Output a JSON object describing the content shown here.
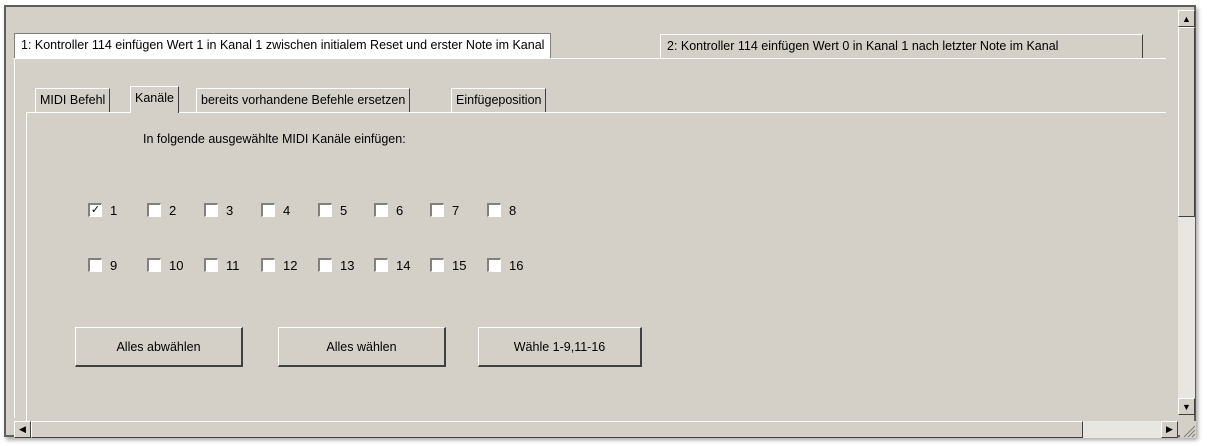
{
  "outer_tabs": [
    {
      "label": "1: Kontroller 114 einfügen Wert 1 in Kanal 1 zwischen initialem Reset und erster Note im Kanal"
    },
    {
      "label": "2: Kontroller 114 einfügen Wert 0 in Kanal 1 nach letzter Note im Kanal"
    }
  ],
  "inner_tabs": [
    {
      "label": "MIDI Befehl"
    },
    {
      "label": "Kanäle"
    },
    {
      "label": "bereits vorhandene Befehle ersetzen"
    },
    {
      "label": "Einfügeposition"
    }
  ],
  "heading": "In folgende ausgewählte MIDI Kanäle einfügen:",
  "channels": [
    {
      "label": "1",
      "checked": true
    },
    {
      "label": "2",
      "checked": false
    },
    {
      "label": "3",
      "checked": false
    },
    {
      "label": "4",
      "checked": false
    },
    {
      "label": "5",
      "checked": false
    },
    {
      "label": "6",
      "checked": false
    },
    {
      "label": "7",
      "checked": false
    },
    {
      "label": "8",
      "checked": false
    },
    {
      "label": "9",
      "checked": false
    },
    {
      "label": "10",
      "checked": false
    },
    {
      "label": "11",
      "checked": false
    },
    {
      "label": "12",
      "checked": false
    },
    {
      "label": "13",
      "checked": false
    },
    {
      "label": "14",
      "checked": false
    },
    {
      "label": "15",
      "checked": false
    },
    {
      "label": "16",
      "checked": false
    }
  ],
  "buttons": {
    "deselect_all": "Alles abwählen",
    "select_all": "Alles wählen",
    "select_preset": "Wähle 1-9,11-16"
  }
}
